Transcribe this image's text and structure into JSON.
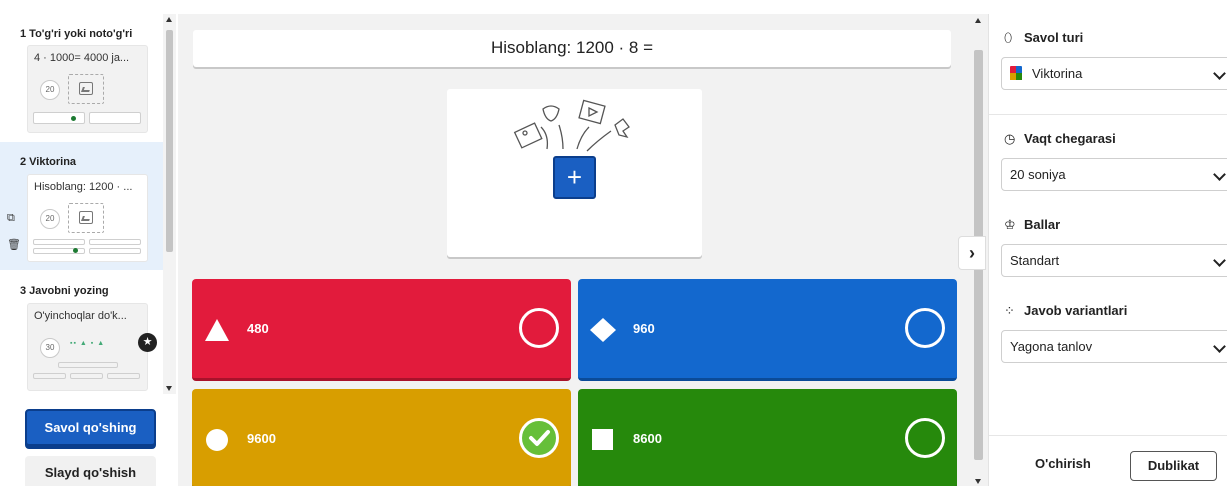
{
  "slides": [
    {
      "number_title": "1  To'g'ri yoki noto'g'ri",
      "preview_text": "4 · 1000= 4000 ja...",
      "time": "20"
    },
    {
      "number_title": "2  Viktorina",
      "preview_text": "Hisoblang: 1200 · ...",
      "time": "20"
    },
    {
      "number_title": "3  Javobni yozing",
      "preview_text": "O'yinchoqlar do'k...",
      "time": "30"
    }
  ],
  "sidebar_buttons": {
    "add_question": "Savol qo'shing",
    "add_slide": "Slayd qo'shish"
  },
  "question": {
    "text": "Hisoblang:  1200 · 8 ="
  },
  "answers": [
    {
      "text": "480",
      "color": "#e21b3c",
      "shape": "triangle",
      "correct": false
    },
    {
      "text": "960",
      "color": "#1368ce",
      "shape": "diamond",
      "correct": false
    },
    {
      "text": "9600",
      "color": "#d89e00",
      "shape": "circle",
      "correct": true
    },
    {
      "text": "8600",
      "color": "#26890c",
      "shape": "square",
      "correct": false
    }
  ],
  "settings": {
    "question_type": {
      "label": "Savol turi",
      "value": "Viktorina"
    },
    "time_limit": {
      "label": "Vaqt chegarasi",
      "value": "20 soniya"
    },
    "points": {
      "label": "Ballar",
      "value": "Standart"
    },
    "answer_options": {
      "label": "Javob variantlari",
      "value": "Yagona tanlov"
    }
  },
  "footer": {
    "delete": "O'chirish",
    "duplicate": "Dublikat"
  }
}
